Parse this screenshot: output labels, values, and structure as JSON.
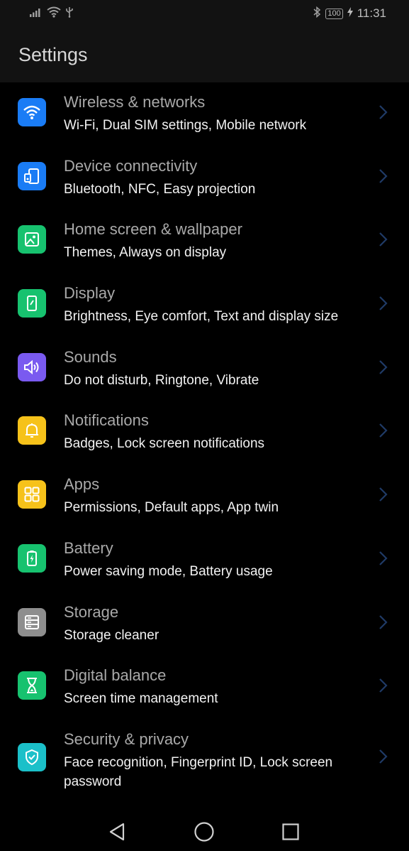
{
  "status_bar": {
    "icons": [
      "signal-icon",
      "wifi-icon",
      "usb-icon"
    ],
    "right_icons": [
      "bluetooth-icon",
      "battery-icon",
      "charging-icon"
    ],
    "battery": "100",
    "time": "11:31"
  },
  "header": {
    "title": "Settings"
  },
  "colors": {
    "wireless": "#1a7cf5",
    "device": "#1a7cf5",
    "home": "#17c26f",
    "display": "#17c26f",
    "sounds": "#7a5af0",
    "notifications": "#f6c21a",
    "apps": "#f6c21a",
    "battery": "#17c26f",
    "storage": "#8e8e8e",
    "digital": "#17c26f",
    "security": "#1bc0c9"
  },
  "settings": [
    {
      "title": "Wireless & networks",
      "subtitle": "Wi-Fi, Dual SIM settings, Mobile network",
      "icon": "wifi-icon"
    },
    {
      "title": "Device connectivity",
      "subtitle": "Bluetooth, NFC, Easy projection",
      "icon": "device-connectivity-icon"
    },
    {
      "title": "Home screen & wallpaper",
      "subtitle": "Themes, Always on display",
      "icon": "wallpaper-icon"
    },
    {
      "title": "Display",
      "subtitle": "Brightness, Eye comfort, Text and display size",
      "icon": "display-icon"
    },
    {
      "title": "Sounds",
      "subtitle": "Do not disturb, Ringtone, Vibrate",
      "icon": "speaker-icon"
    },
    {
      "title": "Notifications",
      "subtitle": "Badges, Lock screen notifications",
      "icon": "bell-icon"
    },
    {
      "title": "Apps",
      "subtitle": "Permissions, Default apps, App twin",
      "icon": "apps-grid-icon"
    },
    {
      "title": "Battery",
      "subtitle": "Power saving mode, Battery usage",
      "icon": "battery-icon"
    },
    {
      "title": "Storage",
      "subtitle": "Storage cleaner",
      "icon": "storage-icon"
    },
    {
      "title": "Digital balance",
      "subtitle": "Screen time management",
      "icon": "hourglass-icon"
    },
    {
      "title": "Security & privacy",
      "subtitle": "Face recognition, Fingerprint ID, Lock screen password",
      "icon": "shield-icon"
    }
  ],
  "nav_bar": {
    "buttons": [
      "back-icon",
      "home-icon",
      "recents-icon"
    ]
  }
}
